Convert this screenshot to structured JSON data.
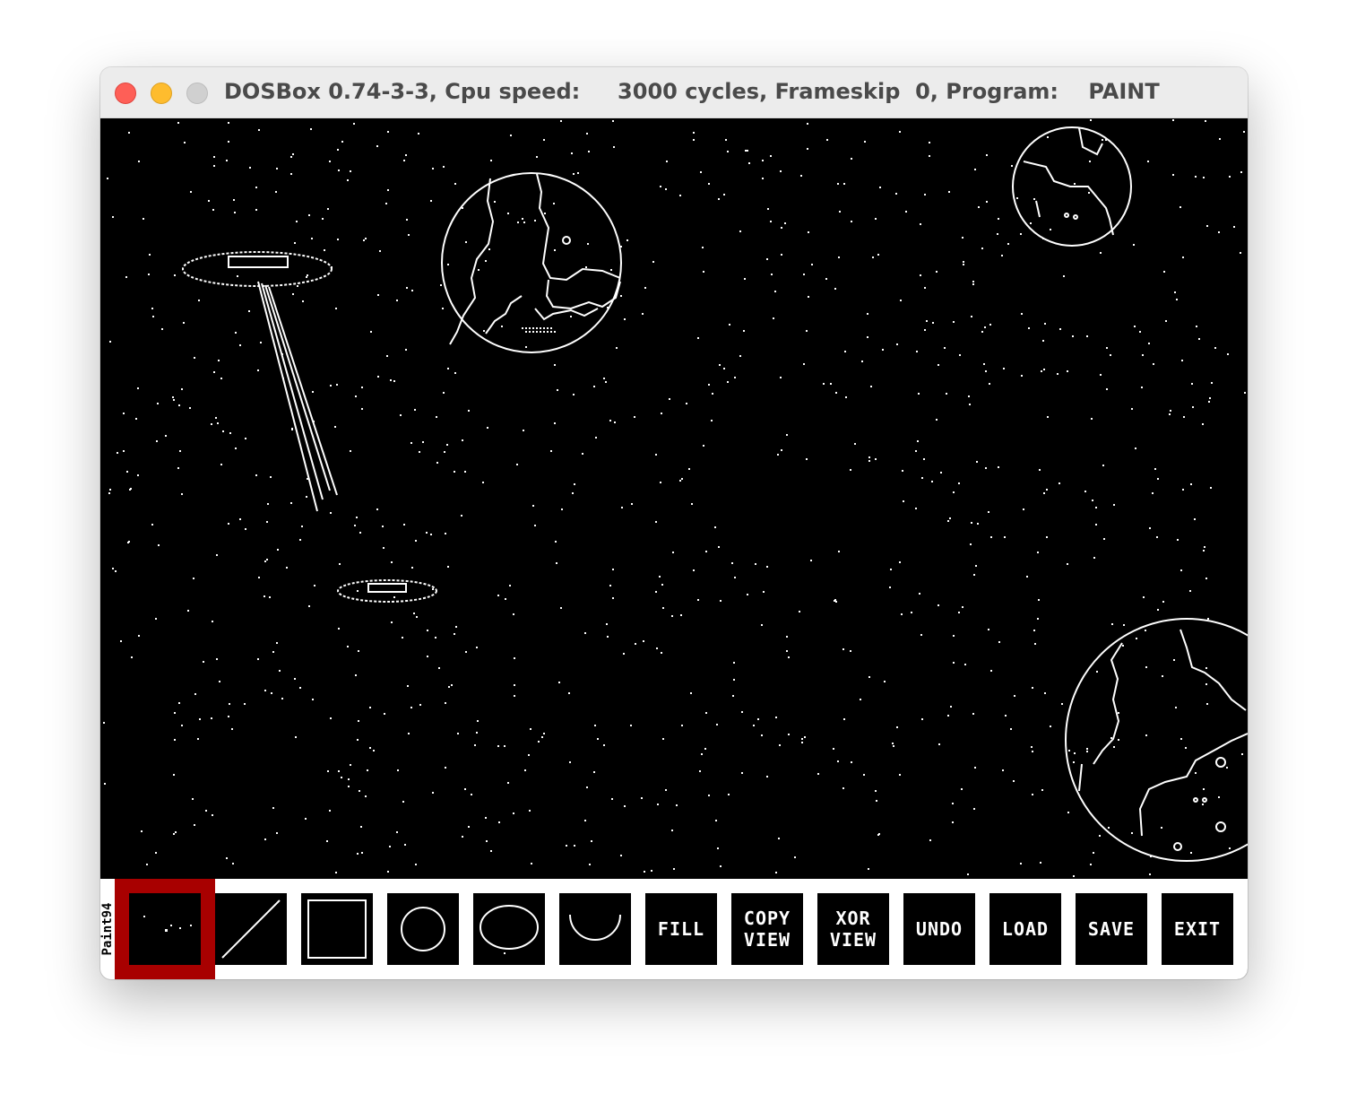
{
  "window": {
    "title": "DOSBox 0.74-3-3, Cpu speed:     3000 cycles, Frameskip  0, Program:    PAINT"
  },
  "app": {
    "brand_label": "Paint94",
    "accent_color": "#a80000",
    "selected_tool": "pixel"
  },
  "toolbar": {
    "tools": [
      {
        "id": "pixel",
        "icon": "dots-icon",
        "lines": []
      },
      {
        "id": "line",
        "icon": "line-icon",
        "lines": []
      },
      {
        "id": "rect",
        "icon": "rectangle-icon",
        "lines": []
      },
      {
        "id": "circle",
        "icon": "circle-icon",
        "lines": []
      },
      {
        "id": "ellipse",
        "icon": "ellipse-icon",
        "lines": []
      },
      {
        "id": "arc",
        "icon": "arc-icon",
        "lines": []
      },
      {
        "id": "fill",
        "icon": "",
        "lines": [
          "FILL"
        ]
      },
      {
        "id": "copy-view",
        "icon": "",
        "lines": [
          "COPY",
          "VIEW"
        ]
      },
      {
        "id": "xor-view",
        "icon": "",
        "lines": [
          "XOR",
          "VIEW"
        ]
      },
      {
        "id": "undo",
        "icon": "",
        "lines": [
          "UNDO"
        ]
      },
      {
        "id": "load",
        "icon": "",
        "lines": [
          "LOAD"
        ]
      },
      {
        "id": "save",
        "icon": "",
        "lines": [
          "SAVE"
        ]
      },
      {
        "id": "exit",
        "icon": "",
        "lines": [
          "EXIT"
        ]
      }
    ]
  }
}
